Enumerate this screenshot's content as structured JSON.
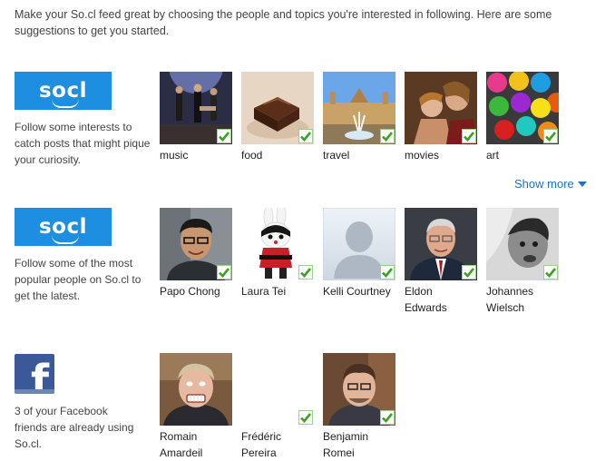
{
  "intro_text": "Make your So.cl feed great by choosing the people and topics you're interested in following. Here are some suggestions to get you started.",
  "interests": {
    "logo_text": "socl",
    "description": "Follow some interests to catch posts that might pique your curiosity.",
    "items": [
      {
        "label": "music",
        "icon": "concert-photo"
      },
      {
        "label": "food",
        "icon": "chocolate-photo"
      },
      {
        "label": "travel",
        "icon": "fountain-palace-photo"
      },
      {
        "label": "movies",
        "icon": "film-still-photo"
      },
      {
        "label": "art",
        "icon": "paint-cups-photo"
      }
    ],
    "show_more": "Show more"
  },
  "people": {
    "logo_text": "socl",
    "description": "Follow some of the most popular people on So.cl to get the latest.",
    "items": [
      {
        "name": "Papo Chong",
        "icon": "person-photo"
      },
      {
        "name": "Laura Tei",
        "icon": "toy-figure-photo"
      },
      {
        "name": "Kelli Courtney",
        "icon": "default-avatar"
      },
      {
        "name": "Eldon Edwards",
        "icon": "person-photo"
      },
      {
        "name": "Johannes Wielsch",
        "icon": "person-photo"
      }
    ]
  },
  "facebook": {
    "description": "3 of your Facebook friends are already using So.cl.",
    "items": [
      {
        "name": "Romain Amardeil",
        "has_photo": true
      },
      {
        "name": "Frédéric Pereira",
        "has_photo": false
      },
      {
        "name": "Benjamin Romei",
        "has_photo": true
      }
    ]
  },
  "colors": {
    "socl_blue": "#1e8ee0",
    "facebook_blue": "#3b5998",
    "link_blue": "#1a73c9",
    "check_green": "#3aa320"
  }
}
